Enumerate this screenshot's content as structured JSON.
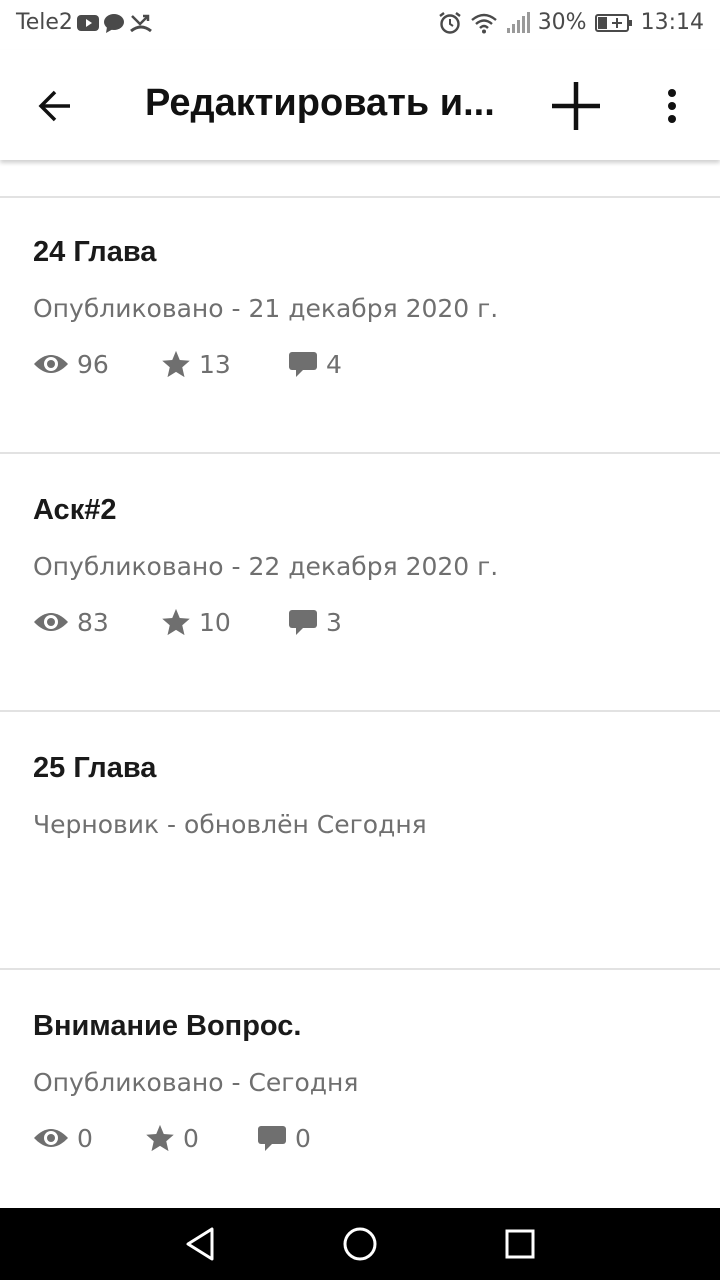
{
  "status_bar": {
    "carrier": "Tele2",
    "battery": "30%",
    "time": "13:14"
  },
  "app_bar": {
    "title": "Редактировать и...",
    "back_icon": "arrow-back-icon",
    "add_icon": "plus-icon",
    "more_icon": "more-vert-icon"
  },
  "parts": [
    {
      "title": "24 Глава",
      "status": "Опубликовано - 21 декабря 2020 г.",
      "views": "96",
      "votes": "13",
      "comments": "4"
    },
    {
      "title": "Аск#2",
      "status": "Опубликовано - 22 декабря 2020 г.",
      "views": "83",
      "votes": "10",
      "comments": "3"
    },
    {
      "title": "25 Глава",
      "status": "Черновик - обновлён Сегодня"
    },
    {
      "title": "Внимание Вопрос.",
      "status": "Опубликовано - Сегодня",
      "views": "0",
      "votes": "0",
      "comments": "0"
    }
  ],
  "colors": {
    "text_primary": "#1a1a1a",
    "text_secondary": "#6f6f6f",
    "divider": "#e2e2e2",
    "nav_bar": "#000000"
  }
}
